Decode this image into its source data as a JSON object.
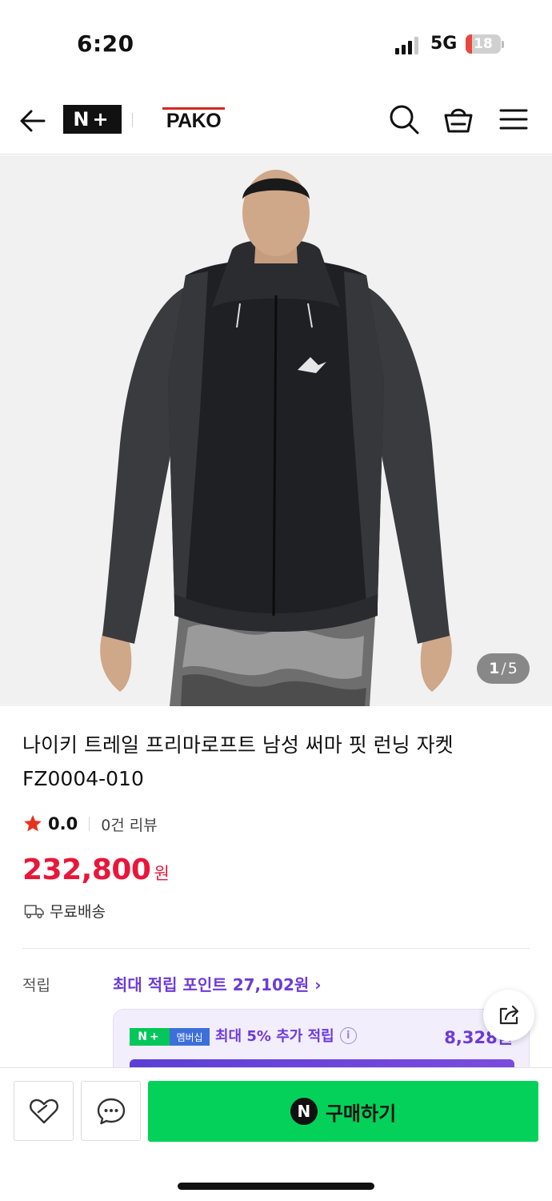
{
  "status_bar": {
    "time": "6:20",
    "network": "5G",
    "battery_level": "18",
    "battery_fraction": 0.18
  },
  "header": {
    "logo_text": "N+",
    "brand_name": "PAKO",
    "back_icon": "arrow-left-icon",
    "search_icon": "search-icon",
    "cart_icon": "shopping-basket-icon",
    "menu_icon": "hamburger-menu-icon"
  },
  "gallery": {
    "current": "1",
    "separator": "/",
    "total": "5"
  },
  "product": {
    "title_line1": "나이키 트레일 프리마로프트 남성 써마 핏 런닝 자켓",
    "title_line2": "FZ0004-010",
    "rating": "0.0",
    "review_count": "0건 리뷰",
    "price": "232,800",
    "price_unit": "원",
    "shipping": "무료배송"
  },
  "points": {
    "label": "적립",
    "max_points": "최대 적립 포인트 27,102원",
    "chevron": "›",
    "membership_badge_n": "N+",
    "membership_badge_text": "멤버십",
    "membership_text": "최대 5% 추가 적립",
    "info_glyph": "i",
    "membership_amount": "8,328원"
  },
  "bottom_bar": {
    "buy_logo": "N",
    "buy_label": "구매하기",
    "wishlist_icon": "heart-icon",
    "chat_icon": "chat-bubble-icon"
  },
  "colors": {
    "price_red": "#e8173a",
    "naver_green": "#03d15a",
    "point_purple": "#6d3bd8"
  }
}
